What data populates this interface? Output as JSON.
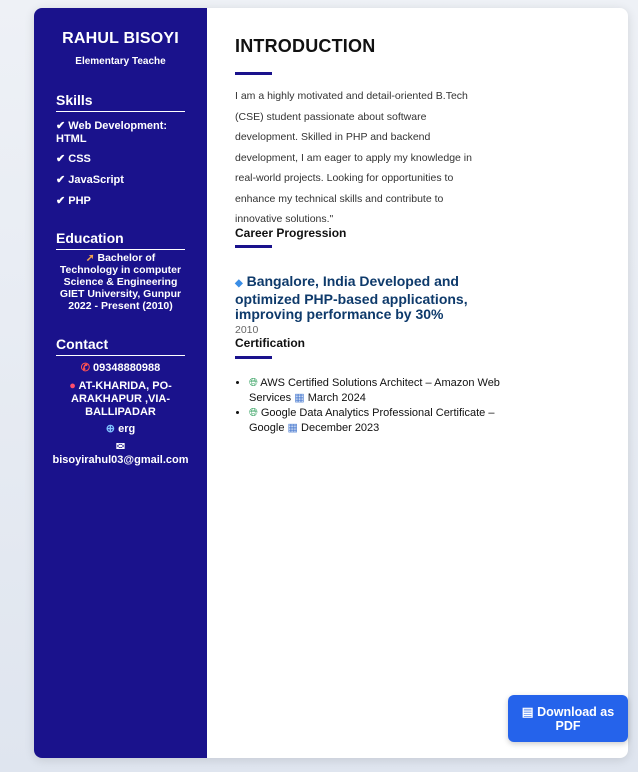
{
  "profile": {
    "name": "RAHUL BISOYI",
    "role": "Elementary Teache"
  },
  "sidebar": {
    "skills": {
      "title": "Skills",
      "items": [
        {
          "icon": "check-icon",
          "label": "Web Development: HTML"
        },
        {
          "icon": "check-icon",
          "label": "CSS"
        },
        {
          "icon": "check-icon",
          "label": "JavaScript"
        },
        {
          "icon": "check-icon",
          "label": "PHP"
        }
      ]
    },
    "education": {
      "title": "Education",
      "icon": "graduation-cap-icon",
      "degree": "Bachelor of Technology in computer Science & Engineering",
      "school": "GIET University, Gunpur",
      "period": "2022 - Present (2010)"
    },
    "contact": {
      "title": "Contact",
      "phone": "09348880988",
      "address": "AT-KHARIDA, PO-ARAKHAPUR ,VIA-BALLIPADAR",
      "website": "erg",
      "email": "bisoyirahul03@gmail.com"
    }
  },
  "main": {
    "intro_title": "INTRODUCTION",
    "intro_text": "I am a highly motivated and detail-oriented B.Tech (CSE) student passionate about software development. Skilled in PHP and backend development, I am eager to apply my knowledge in real-world projects. Looking for opportunities to enhance my technical skills and contribute to innovative solutions.\"",
    "career_title": "Career Progression",
    "job": "Bangalore, India Developed and optimized PHP-based applications, improving performance by 30%",
    "job_year": "2010",
    "cert_title": "Certification",
    "certs": [
      {
        "name": "AWS Certified Solutions Architect – Amazon Web Services",
        "date": "March 2024"
      },
      {
        "name": "Google Data Analytics Professional Certificate – Google",
        "date": "December 2023"
      }
    ]
  },
  "download": {
    "label": "Download as PDF",
    "icon": "document-icon"
  },
  "colors": {
    "sidebar": "#1a128c",
    "accent": "#2563eb",
    "job_title": "#0e3a6b"
  }
}
